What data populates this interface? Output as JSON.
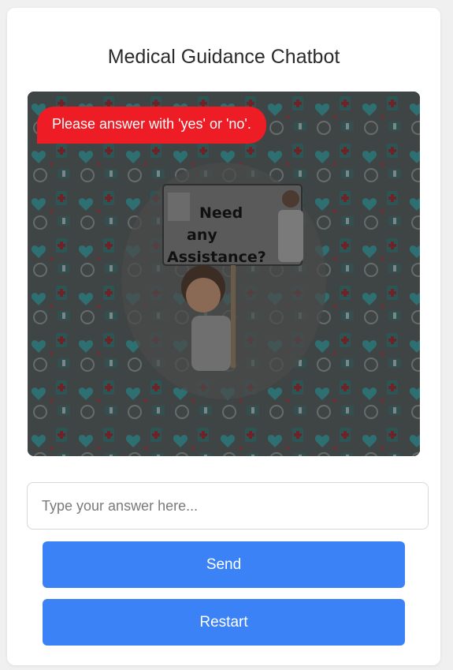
{
  "header": {
    "title": "Medical Guidance Chatbot"
  },
  "chat": {
    "messages": [
      {
        "role": "bot",
        "text": "Please answer with 'yes' or 'no'."
      }
    ],
    "background_art": {
      "poster_text": [
        "Need",
        "any",
        "Assistance?"
      ],
      "icons": [
        "heart-shield-icon",
        "stethoscope-icon",
        "pill-icon",
        "clock-icon",
        "first-aid-kit-icon",
        "doctor-icon",
        "patient-icon"
      ]
    }
  },
  "input": {
    "placeholder": "Type your answer here...",
    "value": ""
  },
  "buttons": {
    "send_label": "Send",
    "restart_label": "Restart"
  },
  "colors": {
    "bubble": "#ee1c25",
    "button": "#3b82f6",
    "chat_overlay": "#3c3c3c"
  }
}
